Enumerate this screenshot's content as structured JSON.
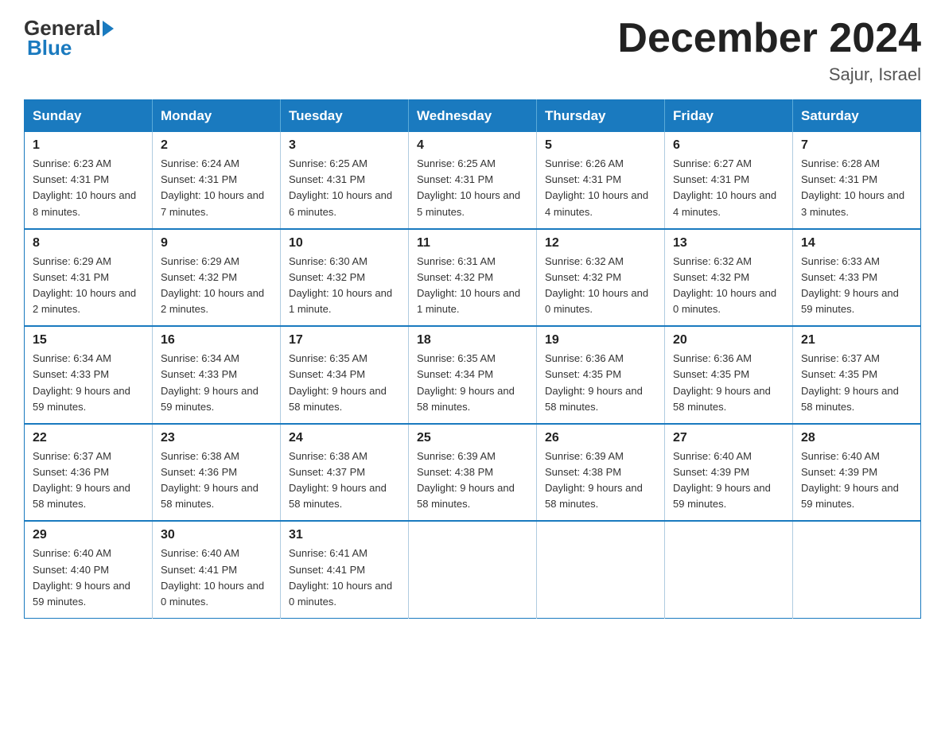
{
  "logo": {
    "text1": "General",
    "text2": "Blue"
  },
  "title": "December 2024",
  "location": "Sajur, Israel",
  "days_of_week": [
    "Sunday",
    "Monday",
    "Tuesday",
    "Wednesday",
    "Thursday",
    "Friday",
    "Saturday"
  ],
  "weeks": [
    [
      {
        "day": "1",
        "sunrise": "6:23 AM",
        "sunset": "4:31 PM",
        "daylight": "10 hours and 8 minutes."
      },
      {
        "day": "2",
        "sunrise": "6:24 AM",
        "sunset": "4:31 PM",
        "daylight": "10 hours and 7 minutes."
      },
      {
        "day": "3",
        "sunrise": "6:25 AM",
        "sunset": "4:31 PM",
        "daylight": "10 hours and 6 minutes."
      },
      {
        "day": "4",
        "sunrise": "6:25 AM",
        "sunset": "4:31 PM",
        "daylight": "10 hours and 5 minutes."
      },
      {
        "day": "5",
        "sunrise": "6:26 AM",
        "sunset": "4:31 PM",
        "daylight": "10 hours and 4 minutes."
      },
      {
        "day": "6",
        "sunrise": "6:27 AM",
        "sunset": "4:31 PM",
        "daylight": "10 hours and 4 minutes."
      },
      {
        "day": "7",
        "sunrise": "6:28 AM",
        "sunset": "4:31 PM",
        "daylight": "10 hours and 3 minutes."
      }
    ],
    [
      {
        "day": "8",
        "sunrise": "6:29 AM",
        "sunset": "4:31 PM",
        "daylight": "10 hours and 2 minutes."
      },
      {
        "day": "9",
        "sunrise": "6:29 AM",
        "sunset": "4:32 PM",
        "daylight": "10 hours and 2 minutes."
      },
      {
        "day": "10",
        "sunrise": "6:30 AM",
        "sunset": "4:32 PM",
        "daylight": "10 hours and 1 minute."
      },
      {
        "day": "11",
        "sunrise": "6:31 AM",
        "sunset": "4:32 PM",
        "daylight": "10 hours and 1 minute."
      },
      {
        "day": "12",
        "sunrise": "6:32 AM",
        "sunset": "4:32 PM",
        "daylight": "10 hours and 0 minutes."
      },
      {
        "day": "13",
        "sunrise": "6:32 AM",
        "sunset": "4:32 PM",
        "daylight": "10 hours and 0 minutes."
      },
      {
        "day": "14",
        "sunrise": "6:33 AM",
        "sunset": "4:33 PM",
        "daylight": "9 hours and 59 minutes."
      }
    ],
    [
      {
        "day": "15",
        "sunrise": "6:34 AM",
        "sunset": "4:33 PM",
        "daylight": "9 hours and 59 minutes."
      },
      {
        "day": "16",
        "sunrise": "6:34 AM",
        "sunset": "4:33 PM",
        "daylight": "9 hours and 59 minutes."
      },
      {
        "day": "17",
        "sunrise": "6:35 AM",
        "sunset": "4:34 PM",
        "daylight": "9 hours and 58 minutes."
      },
      {
        "day": "18",
        "sunrise": "6:35 AM",
        "sunset": "4:34 PM",
        "daylight": "9 hours and 58 minutes."
      },
      {
        "day": "19",
        "sunrise": "6:36 AM",
        "sunset": "4:35 PM",
        "daylight": "9 hours and 58 minutes."
      },
      {
        "day": "20",
        "sunrise": "6:36 AM",
        "sunset": "4:35 PM",
        "daylight": "9 hours and 58 minutes."
      },
      {
        "day": "21",
        "sunrise": "6:37 AM",
        "sunset": "4:35 PM",
        "daylight": "9 hours and 58 minutes."
      }
    ],
    [
      {
        "day": "22",
        "sunrise": "6:37 AM",
        "sunset": "4:36 PM",
        "daylight": "9 hours and 58 minutes."
      },
      {
        "day": "23",
        "sunrise": "6:38 AM",
        "sunset": "4:36 PM",
        "daylight": "9 hours and 58 minutes."
      },
      {
        "day": "24",
        "sunrise": "6:38 AM",
        "sunset": "4:37 PM",
        "daylight": "9 hours and 58 minutes."
      },
      {
        "day": "25",
        "sunrise": "6:39 AM",
        "sunset": "4:38 PM",
        "daylight": "9 hours and 58 minutes."
      },
      {
        "day": "26",
        "sunrise": "6:39 AM",
        "sunset": "4:38 PM",
        "daylight": "9 hours and 58 minutes."
      },
      {
        "day": "27",
        "sunrise": "6:40 AM",
        "sunset": "4:39 PM",
        "daylight": "9 hours and 59 minutes."
      },
      {
        "day": "28",
        "sunrise": "6:40 AM",
        "sunset": "4:39 PM",
        "daylight": "9 hours and 59 minutes."
      }
    ],
    [
      {
        "day": "29",
        "sunrise": "6:40 AM",
        "sunset": "4:40 PM",
        "daylight": "9 hours and 59 minutes."
      },
      {
        "day": "30",
        "sunrise": "6:40 AM",
        "sunset": "4:41 PM",
        "daylight": "10 hours and 0 minutes."
      },
      {
        "day": "31",
        "sunrise": "6:41 AM",
        "sunset": "4:41 PM",
        "daylight": "10 hours and 0 minutes."
      },
      null,
      null,
      null,
      null
    ]
  ],
  "labels": {
    "sunrise": "Sunrise:",
    "sunset": "Sunset:",
    "daylight": "Daylight:"
  }
}
